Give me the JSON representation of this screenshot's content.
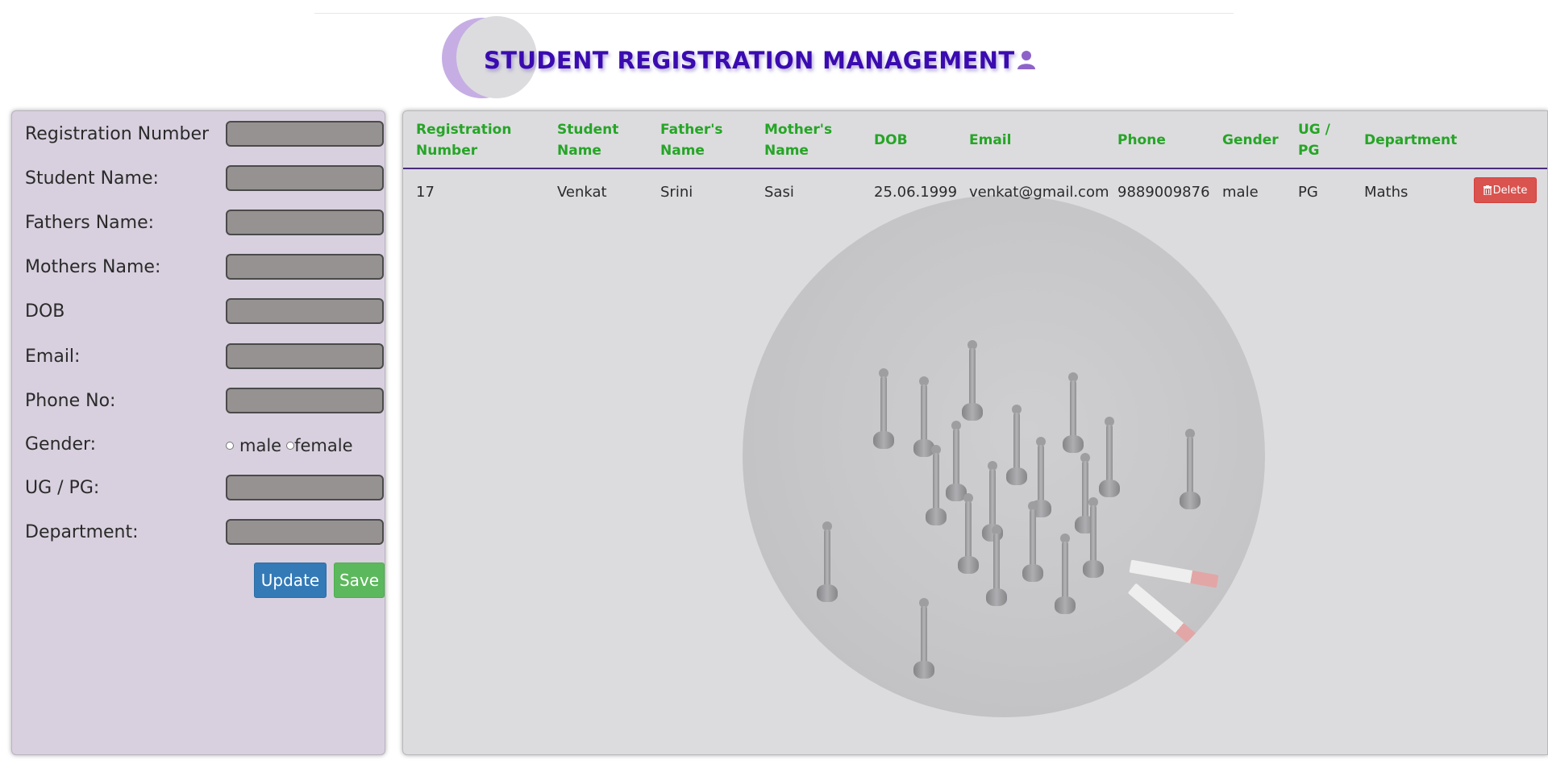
{
  "header": {
    "title": "STUDENT REGISTRATION MANAGEMENT",
    "icon": "user-icon"
  },
  "form": {
    "fields": [
      {
        "label": "Registration Number",
        "value": "",
        "name": "registration-number"
      },
      {
        "label": "Student Name:",
        "value": "",
        "name": "student-name"
      },
      {
        "label": "Fathers Name:",
        "value": "",
        "name": "fathers-name"
      },
      {
        "label": "Mothers Name:",
        "value": "",
        "name": "mothers-name"
      },
      {
        "label": "DOB",
        "value": "",
        "name": "dob"
      },
      {
        "label": "Email:",
        "value": "",
        "name": "email"
      },
      {
        "label": "Phone No:",
        "value": "",
        "name": "phone-no"
      }
    ],
    "gender": {
      "label": "Gender:",
      "options": [
        "male",
        "female"
      ],
      "selected": ""
    },
    "ugpg": {
      "label": "UG / PG:",
      "value": ""
    },
    "department": {
      "label": "Department:",
      "value": ""
    },
    "update_label": "Update",
    "save_label": "Save"
  },
  "table": {
    "columns": [
      "Registration\nNumber",
      "Student\nName",
      "Father's\nName",
      "Mother's\nName",
      "DOB",
      "Email",
      "Phone",
      "Gender",
      "UG /\nPG",
      "Department"
    ],
    "rows": [
      {
        "reg_no": "17",
        "student_name": "Venkat",
        "father_name": "Srini",
        "mother_name": "Sasi",
        "dob": "25.06.1999",
        "email": "venkat@gmail.com",
        "phone": "9889009876",
        "gender": "male",
        "ugpg": "PG",
        "department": "Maths",
        "delete_label": "Delete"
      }
    ]
  },
  "colors": {
    "title": "#3a0bb0",
    "header_text": "#26a526",
    "update_button": "#337ab7",
    "save_button": "#5cb85c",
    "delete_button": "#d9534f",
    "form_panel_bg": "#d8d0de",
    "input_bg": "#979292"
  }
}
